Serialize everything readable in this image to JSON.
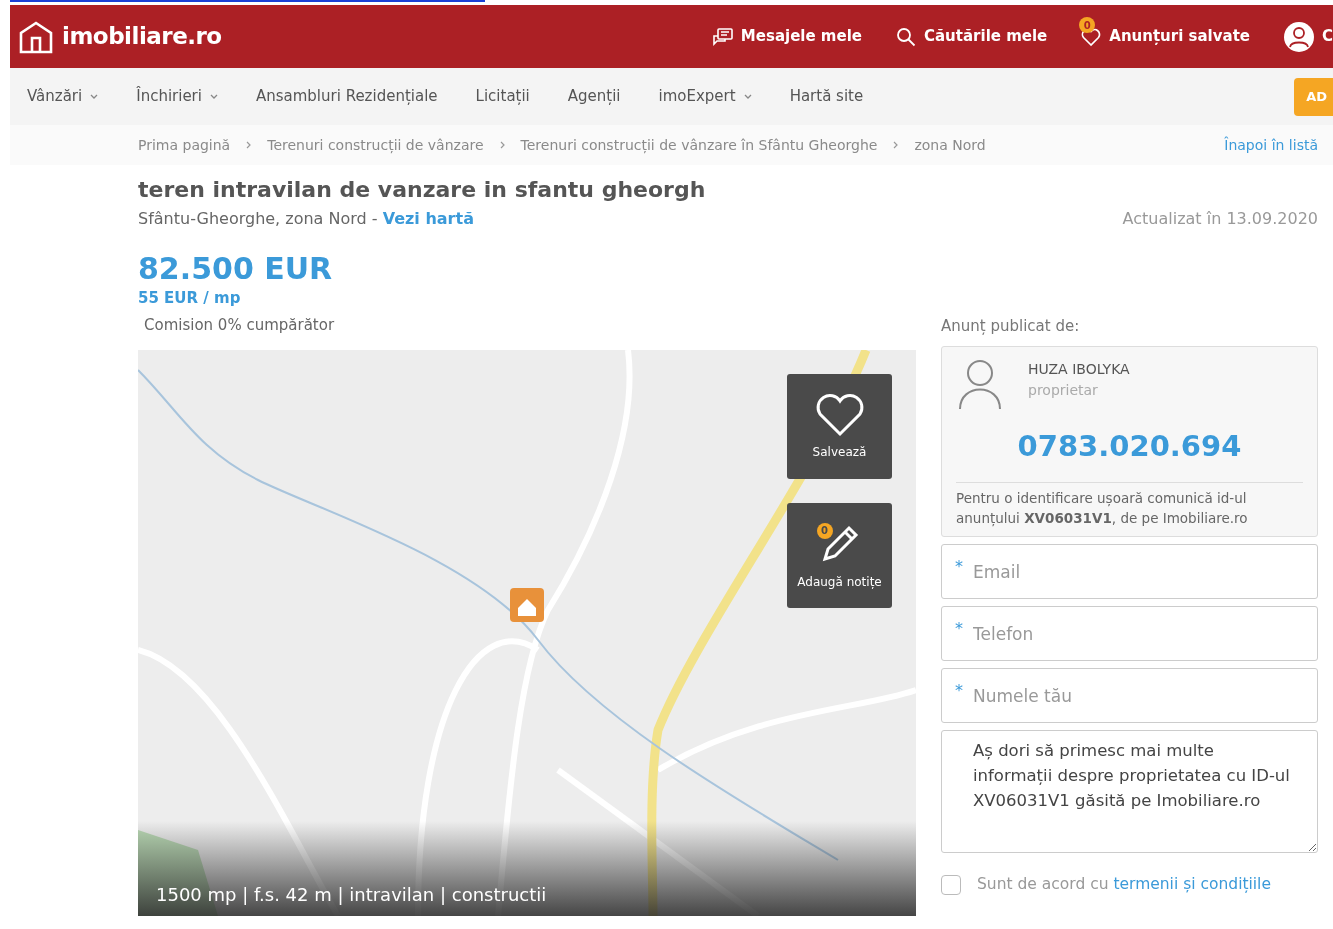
{
  "header": {
    "logo": "imobiliare.ro",
    "links": [
      {
        "label": "Mesajele mele",
        "kind": "messages"
      },
      {
        "label": "Căutările mele",
        "kind": "search"
      },
      {
        "label": "Anunțuri salvate",
        "kind": "saved",
        "badge": "0"
      }
    ],
    "account_label": "C"
  },
  "nav": {
    "items": [
      {
        "label": "Vânzări",
        "dropdown": true
      },
      {
        "label": "Închirieri",
        "dropdown": true
      },
      {
        "label": "Ansambluri Rezidențiale",
        "dropdown": false
      },
      {
        "label": "Licitații",
        "dropdown": false
      },
      {
        "label": "Agenții",
        "dropdown": false
      },
      {
        "label": "imoExpert",
        "dropdown": true
      },
      {
        "label": "Hartă site",
        "dropdown": false
      }
    ],
    "cta": "AD"
  },
  "breadcrumb": {
    "items": [
      "Prima pagină",
      "Terenuri construcții de vânzare",
      "Terenuri construcții de vânzare în Sfântu Gheorghe",
      "zona Nord"
    ],
    "back": "Înapoi în listă"
  },
  "listing": {
    "title": "teren intravilan de vanzare in sfantu gheorgh",
    "location": "Sfântu-Gheorghe, zona Nord - ",
    "map_link": "Vezi hartă",
    "updated": "Actualizat în 13.09.2020",
    "price": "82.500 EUR",
    "price_per_sqm": "55 EUR / mp",
    "commission": "Comision 0% cumpărător"
  },
  "map": {
    "caption": "1500 mp | f.s. 42 m | intravilan | constructii",
    "actions": [
      {
        "label": "Salvează",
        "kind": "save"
      },
      {
        "label": "Adaugă notițe",
        "kind": "notes",
        "badge": "0"
      }
    ]
  },
  "contact": {
    "heading": "Anunț publicat de:",
    "name": "HUZA IBOLYKA",
    "role": "proprietar",
    "phone": "0783.020.694",
    "note": "Pentru o identificare ușoară comunică id-ul anunțului **XV06031V1**, de pe Imobiliare.ro",
    "required_mark": "*",
    "fields": [
      {
        "placeholder": "Email",
        "required": true
      },
      {
        "placeholder": "Telefon",
        "required": true
      },
      {
        "placeholder": "Numele tău",
        "required": true
      }
    ],
    "message": "Aș dori să primesc mai multe informații despre proprietatea cu ID-ul XV06031V1 găsită pe Imobiliare.ro",
    "agree": {
      "checked": false,
      "text": "Sunt de acord cu ",
      "link": "termenii și condițiile"
    }
  }
}
